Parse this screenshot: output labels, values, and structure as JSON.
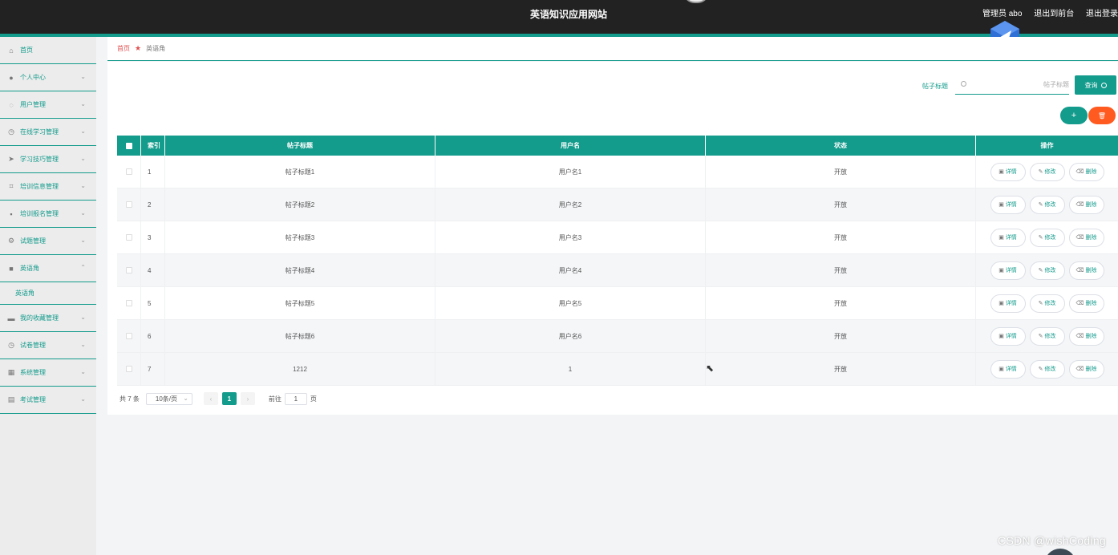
{
  "header": {
    "title": "英语知识应用网站",
    "user_label": "管理员 abo",
    "front_link": "退出到前台",
    "logout_link": "退出登录"
  },
  "sidebar": {
    "items": [
      {
        "label": "首页",
        "icon": "home-icon"
      },
      {
        "label": "个人中心",
        "icon": "user-icon"
      },
      {
        "label": "用户管理",
        "icon": "power-icon"
      },
      {
        "label": "在线学习管理",
        "icon": "clock-icon"
      },
      {
        "label": "学习技巧管理",
        "icon": "send-icon"
      },
      {
        "label": "培训信息管理",
        "icon": "crop-icon"
      },
      {
        "label": "培训报名管理",
        "icon": "message-icon"
      },
      {
        "label": "试题管理",
        "icon": "settings-icon"
      },
      {
        "label": "英语角",
        "icon": "briefcase-icon"
      },
      {
        "label": "英语角",
        "icon": ""
      },
      {
        "label": "我的收藏管理",
        "icon": "folder-icon"
      },
      {
        "label": "试卷管理",
        "icon": "clock-icon"
      },
      {
        "label": "系统管理",
        "icon": "grid-icon"
      },
      {
        "label": "考试管理",
        "icon": "document-icon"
      }
    ]
  },
  "breadcrumb": {
    "home": "首页",
    "current": "英语角"
  },
  "search": {
    "label": "帖子标题",
    "placeholder": "帖子标题",
    "button": "查询"
  },
  "actions": {
    "add": "+",
    "delete_icon": "trash-icon"
  },
  "table": {
    "headers": [
      "索引",
      "帖子标题",
      "用户名",
      "状态",
      "操作"
    ],
    "rows": [
      {
        "index": "1",
        "title": "帖子标题1",
        "user": "用户名1",
        "status": "开放"
      },
      {
        "index": "2",
        "title": "帖子标题2",
        "user": "用户名2",
        "status": "开放"
      },
      {
        "index": "3",
        "title": "帖子标题3",
        "user": "用户名3",
        "status": "开放"
      },
      {
        "index": "4",
        "title": "帖子标题4",
        "user": "用户名4",
        "status": "开放"
      },
      {
        "index": "5",
        "title": "帖子标题5",
        "user": "用户名5",
        "status": "开放"
      },
      {
        "index": "6",
        "title": "帖子标题6",
        "user": "用户名6",
        "status": "开放"
      },
      {
        "index": "7",
        "title": "1212",
        "user": "1",
        "status": "开放"
      }
    ],
    "ops": {
      "detail": "详情",
      "edit": "修改",
      "delete": "删除"
    }
  },
  "pagination": {
    "total": "共 7 条",
    "page_size": "10条/页",
    "current_page": "1",
    "goto_label": "前往",
    "goto_value": "1",
    "goto_suffix": "页"
  },
  "watermark": "CSDN @wishCoding",
  "colors": {
    "accent": "#139b8c",
    "danger": "#ff5a1f",
    "topbar": "#222222"
  }
}
